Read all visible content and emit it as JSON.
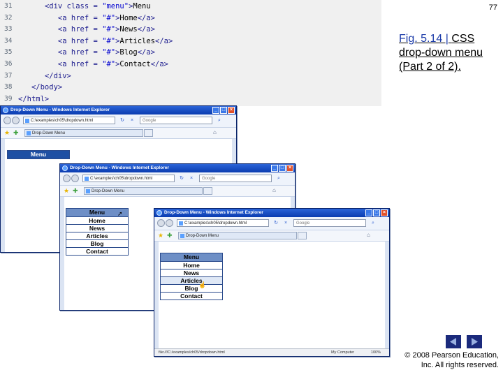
{
  "page_number": "77",
  "caption": {
    "fig_ref": "Fig. 5.14 |",
    "text": "CSS drop-down menu (Part 2 of 2)."
  },
  "copyright": {
    "line1": "© 2008 Pearson Education,",
    "line2": "Inc. All rights reserved."
  },
  "nav": {
    "prev_icon": "prev-arrow-icon",
    "next_icon": "next-arrow-icon",
    "color": "#1b2a7c"
  },
  "code_lines": [
    {
      "num": "31",
      "indent": "      ",
      "parts": [
        [
          "tag",
          "<div class = "
        ],
        [
          "str",
          "\"menu\""
        ],
        [
          "tag",
          ">"
        ],
        [
          "txt",
          "Menu"
        ]
      ]
    },
    {
      "num": "32",
      "indent": "         ",
      "parts": [
        [
          "tag",
          "<a href = "
        ],
        [
          "str",
          "\"#\""
        ],
        [
          "tag",
          ">"
        ],
        [
          "txt",
          "Home"
        ],
        [
          "tag",
          "</a>"
        ]
      ]
    },
    {
      "num": "33",
      "indent": "         ",
      "parts": [
        [
          "tag",
          "<a href = "
        ],
        [
          "str",
          "\"#\""
        ],
        [
          "tag",
          ">"
        ],
        [
          "txt",
          "News"
        ],
        [
          "tag",
          "</a>"
        ]
      ]
    },
    {
      "num": "34",
      "indent": "         ",
      "parts": [
        [
          "tag",
          "<a href = "
        ],
        [
          "str",
          "\"#\""
        ],
        [
          "tag",
          ">"
        ],
        [
          "txt",
          "Articles"
        ],
        [
          "tag",
          "</a>"
        ]
      ]
    },
    {
      "num": "35",
      "indent": "         ",
      "parts": [
        [
          "tag",
          "<a href = "
        ],
        [
          "str",
          "\"#\""
        ],
        [
          "tag",
          ">"
        ],
        [
          "txt",
          "Blog"
        ],
        [
          "tag",
          "</a>"
        ]
      ]
    },
    {
      "num": "36",
      "indent": "         ",
      "parts": [
        [
          "tag",
          "<a href = "
        ],
        [
          "str",
          "\"#\""
        ],
        [
          "tag",
          ">"
        ],
        [
          "txt",
          "Contact"
        ],
        [
          "tag",
          "</a>"
        ]
      ]
    },
    {
      "num": "37",
      "indent": "      ",
      "parts": [
        [
          "tag",
          "</div>"
        ]
      ]
    },
    {
      "num": "38",
      "indent": "   ",
      "parts": [
        [
          "tag",
          "</body>"
        ]
      ]
    },
    {
      "num": "39",
      "indent": "",
      "parts": [
        [
          "tag",
          "</html>"
        ]
      ]
    }
  ],
  "browser": {
    "title": "Drop-Down Menu - Windows Internet Explorer",
    "address": "C:\\examples\\ch05\\dropdown.html",
    "search_placeholder": "Google",
    "tab_label": "Drop-Down Menu",
    "status_path": "file:///C:/examples/ch05/dropdown.html",
    "status_zone": "My Computer",
    "status_zoom": "100%"
  },
  "menu": {
    "header": "Menu",
    "items": [
      "Home",
      "News",
      "Articles",
      "Blog",
      "Contact"
    ],
    "header_color": "#1e4fa3",
    "hover_color": "#dfe8f6"
  },
  "windows": [
    {
      "state": "collapsed"
    },
    {
      "state": "expanded-hover-menu"
    },
    {
      "state": "expanded-hover-articles"
    }
  ]
}
